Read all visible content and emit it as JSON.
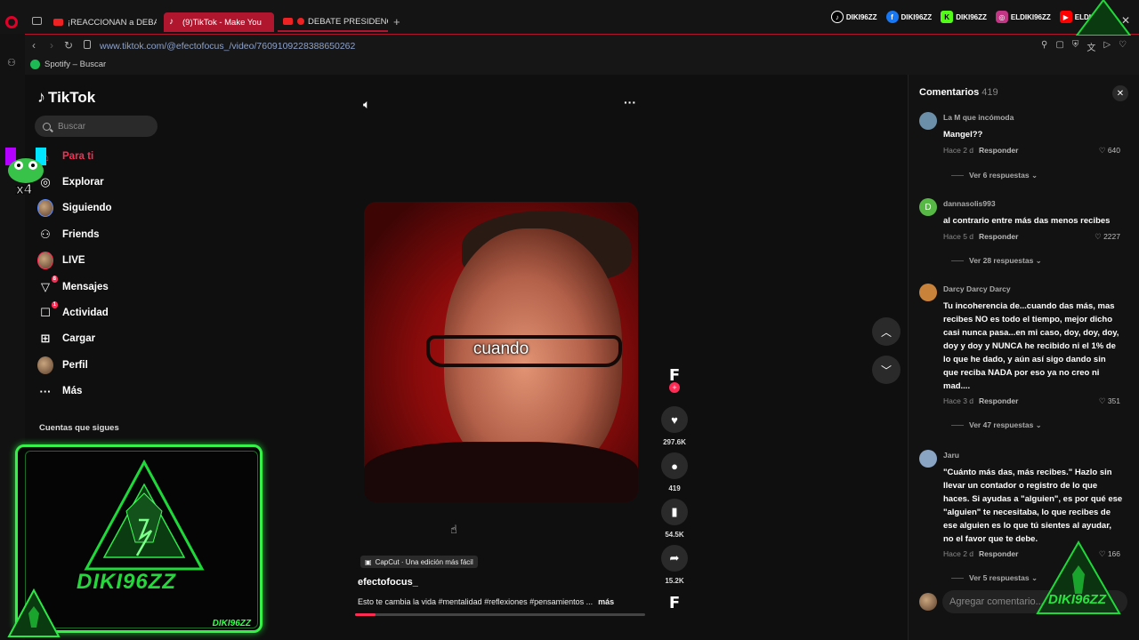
{
  "browser": {
    "tabs": [
      {
        "label": "¡REACCIONAN a DEBA",
        "icon": "youtube-icon"
      },
      {
        "label": "(9)TikTok - Make You",
        "icon": "tiktok-icon"
      },
      {
        "label": "DEBATE PRESIDENCIA",
        "icon": "youtube-icon"
      }
    ],
    "url": "www.tiktok.com/@efectofocus_/video/7609109228388650262",
    "bookmark": "Spotify – Buscar"
  },
  "overlay": {
    "socials": [
      "DIKI96ZZ",
      "DIKI96ZZ",
      "DIKI96ZZ",
      "ELDIKI96ZZ",
      "ELDIKI"
    ],
    "frog_badge": "x4",
    "cam_brand": "DIKI96ZZ",
    "cam_small": "DIKI96ZZ",
    "bottom_brand": "DIKI96ZZ"
  },
  "tiktok": {
    "logo": "TikTok",
    "search_placeholder": "Buscar",
    "nav": [
      {
        "label": "Para ti",
        "icon": "home-icon",
        "active": true
      },
      {
        "label": "Explorar",
        "icon": "compass-icon"
      },
      {
        "label": "Siguiendo",
        "icon": "avatar"
      },
      {
        "label": "Friends",
        "icon": "friends-icon"
      },
      {
        "label": "LIVE",
        "icon": "live-icon"
      },
      {
        "label": "Mensajes",
        "icon": "send-icon",
        "badge": "8"
      },
      {
        "label": "Actividad",
        "icon": "inbox-icon",
        "badge": "1"
      },
      {
        "label": "Cargar",
        "icon": "upload-icon"
      },
      {
        "label": "Perfil",
        "icon": "avatar"
      },
      {
        "label": "Más",
        "icon": "more-icon"
      }
    ],
    "following_title": "Cuentas que sigues"
  },
  "video": {
    "caption": "cuando",
    "capcut": "CapCut · Una edición más fácil",
    "author": "efectofocus_",
    "description": "Esto te cambia la vida #mentalidad #reflexiones #pensamientos ...",
    "more": "más",
    "progress": 0.07,
    "likes": "297.6K",
    "comments": "419",
    "saves": "54.5K",
    "shares": "15.2K"
  },
  "comments": {
    "title": "Comentarios",
    "count": "419",
    "reply_label": "Responder",
    "input_placeholder": "Agregar comentario...",
    "items": [
      {
        "user": "La M que incómoda",
        "text": "Mangel??",
        "time": "Hace 2 d",
        "likes": "640",
        "replies": "Ver 6 respuestas",
        "avatar_color": "#6b8fa8"
      },
      {
        "user": "dannasolis993",
        "text": "al contrario entre más das menos recibes",
        "time": "Hace 5 d",
        "likes": "2227",
        "replies": "Ver 28 respuestas",
        "avatar_color": "#57b846",
        "avatar_letter": "D"
      },
      {
        "user": "Darcy Darcy Darcy",
        "text": "Tu incoherencia de...cuando das más, mas recibes NO es todo el tiempo, mejor dicho casi nunca pasa...en mi caso, doy, doy, doy, doy y doy y NUNCA he recibido ni el 1% de lo que he dado, y aún así sigo dando sin que reciba NADA por eso ya no creo ni mad....",
        "time": "Hace 3 d",
        "likes": "351",
        "replies": "Ver 47 respuestas",
        "avatar_color": "#c9823a"
      },
      {
        "user": "Jaru",
        "text": "\"Cuánto más das, más recibes.\" Hazlo sin llevar un contador o registro de lo que haces. Si ayudas a \"alguien\", es por qué ese \"alguien\" te necesitaba, lo que recibes de ese alguien es lo que tú sientes al ayudar, no el favor que te debe.",
        "time": "Hace 2 d",
        "likes": "166",
        "replies": "Ver 5 respuestas",
        "avatar_color": "#8aa4c4"
      }
    ]
  }
}
